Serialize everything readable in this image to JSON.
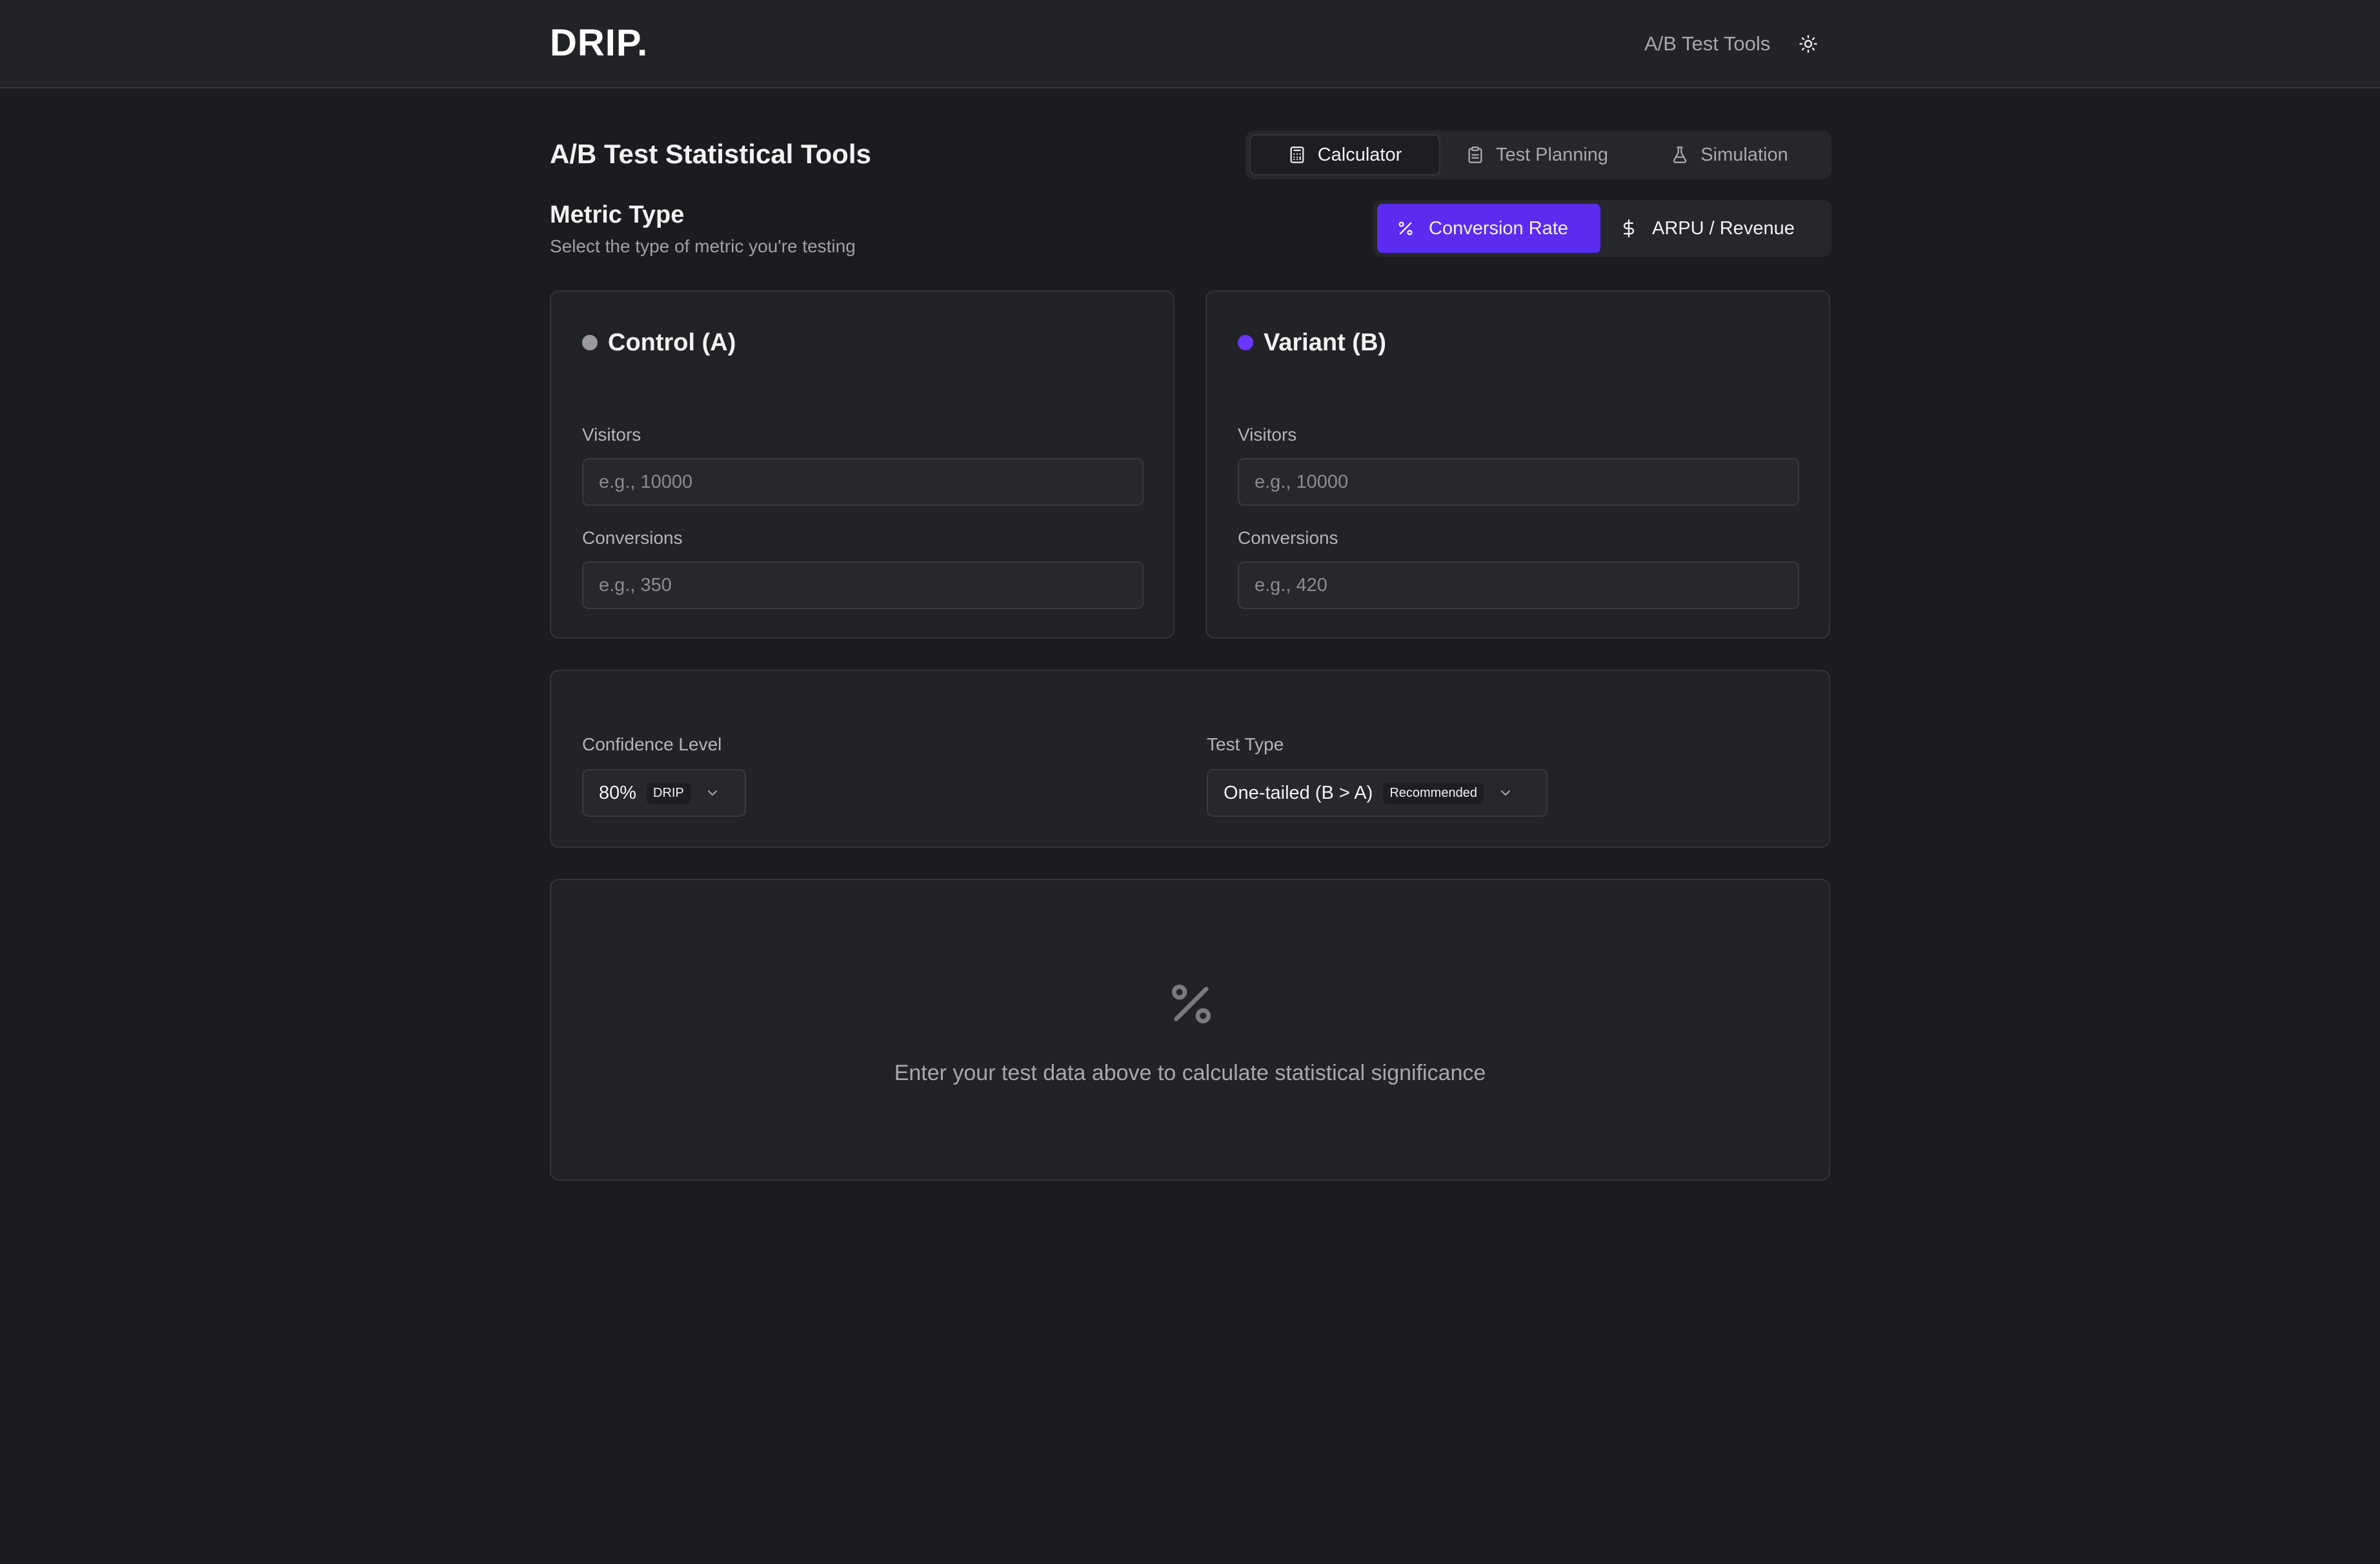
{
  "header": {
    "brand": "DRIP.",
    "nav_link": "A/B Test Tools",
    "theme_icon": "sun-icon"
  },
  "page": {
    "title": "A/B Test Statistical Tools"
  },
  "tabs": [
    {
      "label": "Calculator",
      "icon": "calculator-icon",
      "active": true
    },
    {
      "label": "Test Planning",
      "icon": "clipboard-icon",
      "active": false
    },
    {
      "label": "Simulation",
      "icon": "flask-icon",
      "active": false
    }
  ],
  "metric": {
    "title": "Metric Type",
    "subtitle": "Select the type of metric you're testing",
    "options": [
      {
        "label": "Conversion Rate",
        "icon": "percent-icon",
        "active": true
      },
      {
        "label": "ARPU / Revenue",
        "icon": "dollar-icon",
        "active": false
      }
    ]
  },
  "control": {
    "title": "Control (A)",
    "dot_color": "#9a9a9f",
    "visitors_label": "Visitors",
    "visitors_value": "",
    "visitors_placeholder": "e.g., 10000",
    "conversions_label": "Conversions",
    "conversions_value": "",
    "conversions_placeholder": "e.g., 350"
  },
  "variant": {
    "title": "Variant (B)",
    "dot_color": "#6a35ff",
    "visitors_label": "Visitors",
    "visitors_value": "",
    "visitors_placeholder": "e.g., 10000",
    "conversions_label": "Conversions",
    "conversions_value": "",
    "conversions_placeholder": "e.g., 420"
  },
  "settings": {
    "confidence_label": "Confidence Level",
    "confidence_value": "80%",
    "confidence_badge": "DRIP",
    "test_type_label": "Test Type",
    "test_type_value": "One-tailed (B > A)",
    "test_type_badge": "Recommended"
  },
  "results": {
    "icon": "percent-icon",
    "empty_message": "Enter your test data above to calculate statistical significance"
  },
  "colors": {
    "accent": "#5b2bf0",
    "background": "#1b1c20",
    "card": "#222327"
  }
}
